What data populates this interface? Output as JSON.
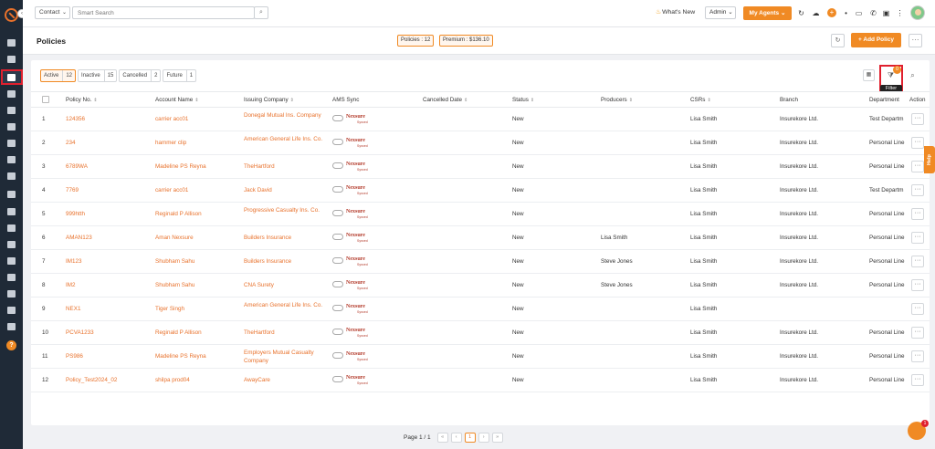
{
  "topbar": {
    "contact_select": "Contact",
    "search_placeholder": "Smart Search",
    "whats_new": "What's New",
    "admin_select": "Admin",
    "my_agents": "My Agents"
  },
  "header": {
    "title": "Policies",
    "policies_badge": "Policies : 12",
    "premium_badge": "Premium : $136.10",
    "add_policy": "+ Add Policy",
    "more": "···"
  },
  "filter_tabs": [
    {
      "label": "Active",
      "count": "12",
      "active": true
    },
    {
      "label": "Inactive",
      "count": "15",
      "active": false
    },
    {
      "label": "Cancelled",
      "count": "2",
      "active": false
    },
    {
      "label": "Future",
      "count": "1",
      "active": false
    }
  ],
  "filter": {
    "count": "0",
    "tooltip": "Filter"
  },
  "columns": [
    "Policy No.",
    "Account Name",
    "Issuing Company",
    "AMS Sync",
    "Cancelled Date",
    "Status",
    "Producers",
    "CSRs",
    "Branch",
    "Department",
    "Action"
  ],
  "ams_logo": {
    "name": "Nexsure",
    "tag": "Synced"
  },
  "rows": [
    {
      "num": "1",
      "policy": "124356",
      "account": "carrier acc01",
      "issuing": "Donegal Mutual Ins. Company",
      "status": "New",
      "producers": "",
      "csrs": "Lisa Smith",
      "branch": "Insurekore Ltd.",
      "dept": "Test Departm"
    },
    {
      "num": "2",
      "policy": "234",
      "account": "hammer clip",
      "issuing": "American General Life Ins. Co.",
      "status": "New",
      "producers": "",
      "csrs": "Lisa Smith",
      "branch": "Insurekore Ltd.",
      "dept": "Personal Line"
    },
    {
      "num": "3",
      "policy": "6789WA",
      "account": "Madeline PS Reyna",
      "issuing": "TheHartford",
      "status": "New",
      "producers": "",
      "csrs": "Lisa Smith",
      "branch": "Insurekore Ltd.",
      "dept": "Personal Line"
    },
    {
      "num": "4",
      "policy": "7769",
      "account": "carrier acc01",
      "issuing": "Jack David",
      "status": "New",
      "producers": "",
      "csrs": "Lisa Smith",
      "branch": "Insurekore Ltd.",
      "dept": "Test Departm"
    },
    {
      "num": "5",
      "policy": "999htth",
      "account": "Reginald P Allison",
      "issuing": "Progressive Casualty Ins. Co.",
      "status": "New",
      "producers": "",
      "csrs": "Lisa Smith",
      "branch": "Insurekore Ltd.",
      "dept": "Personal Line"
    },
    {
      "num": "6",
      "policy": "AMAN123",
      "account": "Aman Nexsure",
      "issuing": "Builders Insurance",
      "status": "New",
      "producers": "Lisa Smith",
      "csrs": "Lisa Smith",
      "branch": "Insurekore Ltd.",
      "dept": "Personal Line"
    },
    {
      "num": "7",
      "policy": "IM123",
      "account": "Shubham Sahu",
      "issuing": "Builders Insurance",
      "status": "New",
      "producers": "Steve Jones",
      "csrs": "Lisa Smith",
      "branch": "Insurekore Ltd.",
      "dept": "Personal Line"
    },
    {
      "num": "8",
      "policy": "IM2",
      "account": "Shubham Sahu",
      "issuing": "CNA Surety",
      "status": "New",
      "producers": "Steve Jones",
      "csrs": "Lisa Smith",
      "branch": "Insurekore Ltd.",
      "dept": "Personal Line"
    },
    {
      "num": "9",
      "policy": "NEX1",
      "account": "Tiger Singh",
      "issuing": "American General Life Ins. Co.",
      "status": "New",
      "producers": "",
      "csrs": "Lisa Smith",
      "branch": "",
      "dept": ""
    },
    {
      "num": "10",
      "policy": "PCVA1233",
      "account": "Reginald P Allison",
      "issuing": "TheHartford",
      "status": "New",
      "producers": "",
      "csrs": "Lisa Smith",
      "branch": "Insurekore Ltd.",
      "dept": "Personal Line"
    },
    {
      "num": "11",
      "policy": "PS986",
      "account": "Madeline PS Reyna",
      "issuing": "Employers Mutual Casualty Company",
      "status": "New",
      "producers": "",
      "csrs": "Lisa Smith",
      "branch": "Insurekore Ltd.",
      "dept": "Personal Line"
    },
    {
      "num": "12",
      "policy": "Policy_Test2024_02",
      "account": "shilpa prod04",
      "issuing": "AwayCare",
      "status": "New",
      "producers": "",
      "csrs": "Lisa Smith",
      "branch": "Insurekore Ltd.",
      "dept": "Personal Line"
    }
  ],
  "pagination": {
    "text": "Page 1 / 1",
    "first": "«",
    "prev": "‹",
    "current": "1",
    "next": "›",
    "last": "»"
  },
  "help_tab": "Help",
  "chat_badge": "1",
  "colors": {
    "accent": "#f08a24",
    "link": "#e8712b",
    "sidebar": "#1f2a37",
    "highlight": "#e0202e"
  }
}
